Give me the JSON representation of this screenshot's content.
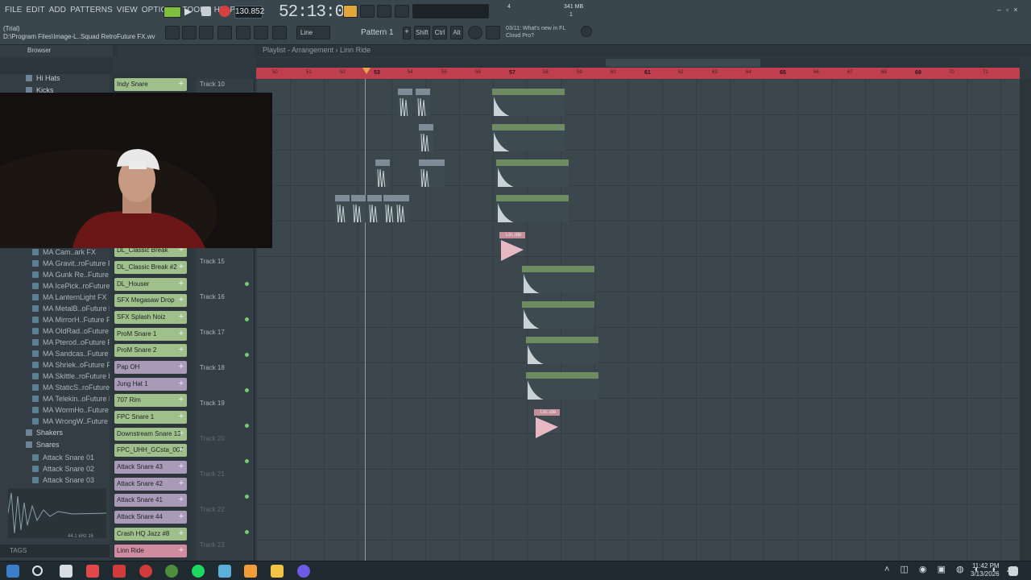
{
  "menu": [
    "FILE",
    "EDIT",
    "ADD",
    "PATTERNS",
    "VIEW",
    "OPTIONS",
    "TOOLS",
    "HELP"
  ],
  "hint": {
    "line1": "(Trial)",
    "line2": "D:\\Program Files\\Image-L..Squad RetroFuture FX.wv"
  },
  "tempo": "130.852",
  "clock": "52:13:00",
  "pattern_label": "Pattern 1",
  "snap": "Line",
  "mods": [
    "Shift",
    "Ctrl",
    "Alt"
  ],
  "news": {
    "line1": "03/11: What's new in FL",
    "line2": "Cloud Pro?"
  },
  "meters": {
    "cpu": "4",
    "mem": "341 MB",
    "voices": "1"
  },
  "browser": {
    "title": "Browser",
    "folders_top": [
      "Hi Hats",
      "Kicks"
    ],
    "folders_bottom": [
      "Shakers",
      "Snares"
    ]
  },
  "browser_items": [
    "MA Cam..ark FX",
    "MA Gravit..roFuture FX",
    "MA Gunk Re..Future FX",
    "MA IcePick..roFuture FX",
    "MA LanternLight FX",
    "MA MetalB..oFuture FX",
    "MA MirrorH..Future FX",
    "MA OldRad..oFuture FX",
    "MA Pterod..oFuture FX",
    "MA Sandcas..Future FX",
    "MA Shriek..oFuture FX",
    "MA Skittle..roFuture FX",
    "MA StaticS..roFuture FX",
    "MA Telekin..oFuture FX",
    "MA WormHo..Future FX",
    "MA WrongW..Future FX"
  ],
  "snare_items": [
    "Attack Snare 01",
    "Attack Snare 02",
    "Attack Snare 03"
  ],
  "wave_info": "44.1 kHz 16",
  "tags": "TAGS",
  "playlist_title": "Playlist - Arrangement",
  "playlist_sub": "Linn Ride",
  "channels": [
    "Indy Snare",
    "DL_Classic Break",
    "DL_Classic Break #2",
    "DL_Houser",
    "SFX Megasaw Drop",
    "SFX Splash Noiz",
    "ProM Snare 1",
    "ProM Snare 2",
    "Pap OH",
    "Jung Hat 1",
    "707 Rim",
    "FPC Snare 1",
    "Downstream Snare 13",
    "FPC_UHH_GCsta_007",
    "Attack Snare 43",
    "Attack Snare 42",
    "Attack Snare 41",
    "Attack Snare 44",
    "Crash HQ Jazz #8",
    "Linn Ride"
  ],
  "tracks": [
    "Track 10",
    "Track 15",
    "Track 16",
    "Track 17",
    "Track 18",
    "Track 19",
    "Track 20",
    "Track 21",
    "Track 22",
    "Track 23"
  ],
  "ruler": [
    "50",
    "51",
    "52",
    "53",
    "54",
    "55",
    "56",
    "57",
    "58",
    "59",
    "60",
    "61",
    "62",
    "63",
    "64",
    "65",
    "66",
    "67",
    "68",
    "69",
    "70",
    "71"
  ],
  "clip_labels": {
    "crash": "Crash HQ Jazz #8",
    "linn": "Lin..ide",
    "jun": "Jun..1"
  },
  "taskbar": {
    "time": "11:42 PM",
    "date": "3/13/2026"
  },
  "colors": {
    "ruler": "#c03f4f",
    "clip_green": "#6f8b61",
    "clip_pink": "#c58f9a",
    "channel_green": "#9fc08a",
    "channel_purple": "#a99bb7",
    "channel_pink": "#cf8ba0"
  }
}
